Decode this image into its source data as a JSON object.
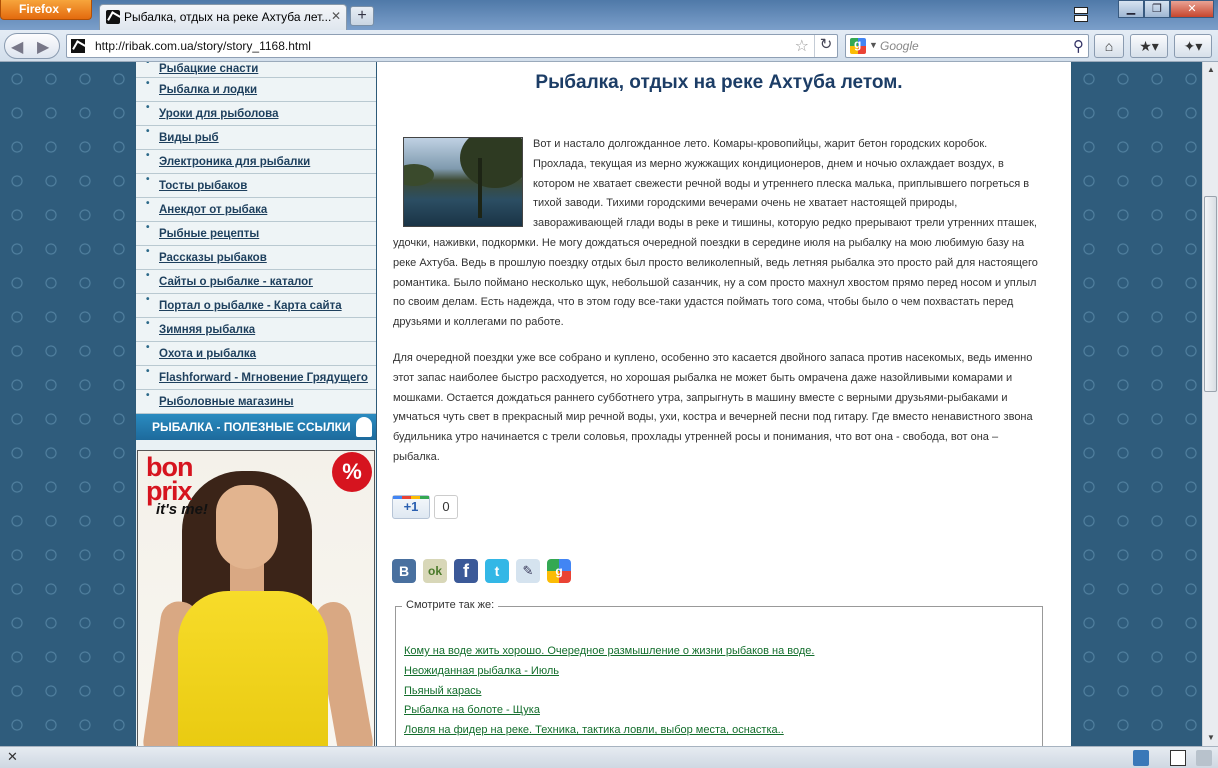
{
  "browser": {
    "app_button": "Firefox",
    "tab_title": "Рыбалка, отдых на реке Ахтуба лет...",
    "url": "http://ribak.com.ua/story/story_1168.html",
    "search_placeholder": "Google"
  },
  "sidebar": {
    "items": [
      "Рыбацкие снасти",
      "Рыбалка и лодки",
      "Уроки для рыболова",
      "Виды рыб",
      "Электроника для рыбалки",
      "Тосты рыбаков",
      "Анекдот от рыбака",
      "Рыбные рецепты",
      "Рассказы рыбаков",
      "Сайты о рыбалке - каталог",
      "Портал о рыбалке - Карта сайта",
      "Зимняя рыбалка",
      "Охота и рыбалка",
      "Flashforward - Мгновение Грядущего",
      "Рыболовные магазины"
    ],
    "section_header": "РЫБАЛКА - ПОЛЕЗНЫЕ ССЫЛКИ",
    "ad": {
      "brand_line1": "bon",
      "brand_line2": "prix",
      "tagline": "it's me!",
      "badge": "%"
    }
  },
  "article": {
    "title": "Рыбалка, отдых на реке Ахтуба летом.",
    "paragraph1": "Вот и настало долгожданное лето. Комары-кровопийцы, жарит бетон городских коробок. Прохлада, текущая из мерно жужжащих кондиционеров, днем и ночью охлаждает воздух, в котором не хватает свежести речной воды и утреннего плеска малька, приплывшего погреться в тихой заводи. Тихими городскими вечерами очень не хватает настоящей природы, завораживающей глади воды в реке и тишины, которую редко прерывают трели утренних пташек, удочки, наживки, подкормки. Не могу дождаться очередной поездки в середине июля на рыбалку на мою любимую базу на реке Ахтуба. Ведь в прошлую поездку отдых был просто великолепный, ведь летняя рыбалка это просто рай для настоящего романтика. Было поймано несколько щук, небольшой сазанчик, ну а сом просто махнул хвостом прямо перед носом и уплыл по своим делам. Есть надежда, что в этом году все-таки удастся поймать того сома, чтобы было о чем похвастать перед друзьями и коллегами по работе.",
    "paragraph2": "Для очередной поездки уже все собрано и куплено, особенно это касается двойного запаса против насекомых, ведь именно этот запас наиболее быстро расходуется, но хорошая рыбалка не может быть омрачена даже назойливыми комарами и мошками. Остается дождаться раннего субботнего утра, запрыгнуть в машину вместе с верными друзьями-рыбаками и умчаться чуть свет в прекрасный мир речной воды, ухи, костра и вечерней песни под гитару. Где вместо ненавистного звона будильника утро начинается с трели соловья, прохлады утренней росы и понимания, что вот она - свобода, вот она – рыбалка.",
    "gplus_label": "+1",
    "gplus_count": "0",
    "share": {
      "vk": "В",
      "odnoklassniki": "ok",
      "facebook": "f",
      "twitter": "t",
      "livejournal": "✎",
      "google_bookmarks": "g"
    },
    "see_also": {
      "legend": "Смотрите так же:",
      "links": [
        "Кому на воде жить хорошо. Очередное размышление о жизни рыбаков на воде.",
        "Неожиданная рыбалка - Июль",
        "Пьяный карась",
        "Рыбалка на болоте - Щука",
        "Ловля на фидер на реке. Техника, тактика ловли, выбор места, оснастка.."
      ]
    }
  }
}
